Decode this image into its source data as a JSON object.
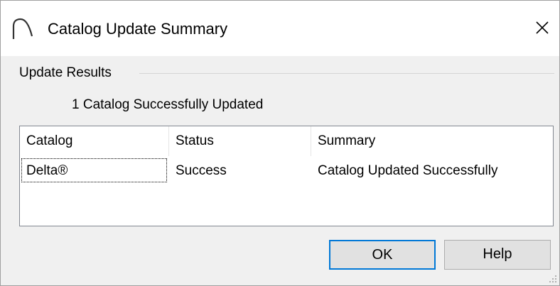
{
  "window": {
    "title": "Catalog Update Summary",
    "close_glyph": "✕"
  },
  "group": {
    "label": "Update Results",
    "result_text": "1 Catalog Successfully Updated"
  },
  "table": {
    "columns": [
      "Catalog",
      "Status",
      "Summary"
    ],
    "rows": [
      {
        "catalog": "Delta®",
        "status": "Success",
        "summary": "Catalog Updated Successfully"
      }
    ]
  },
  "buttons": {
    "ok_label": "OK",
    "help_label": "Help"
  },
  "colors": {
    "focus_accent": "#0078d7",
    "dialog_background": "#f0f0f0"
  },
  "icons": [
    "app-arc-icon",
    "close-icon",
    "resize-grip-icon"
  ]
}
